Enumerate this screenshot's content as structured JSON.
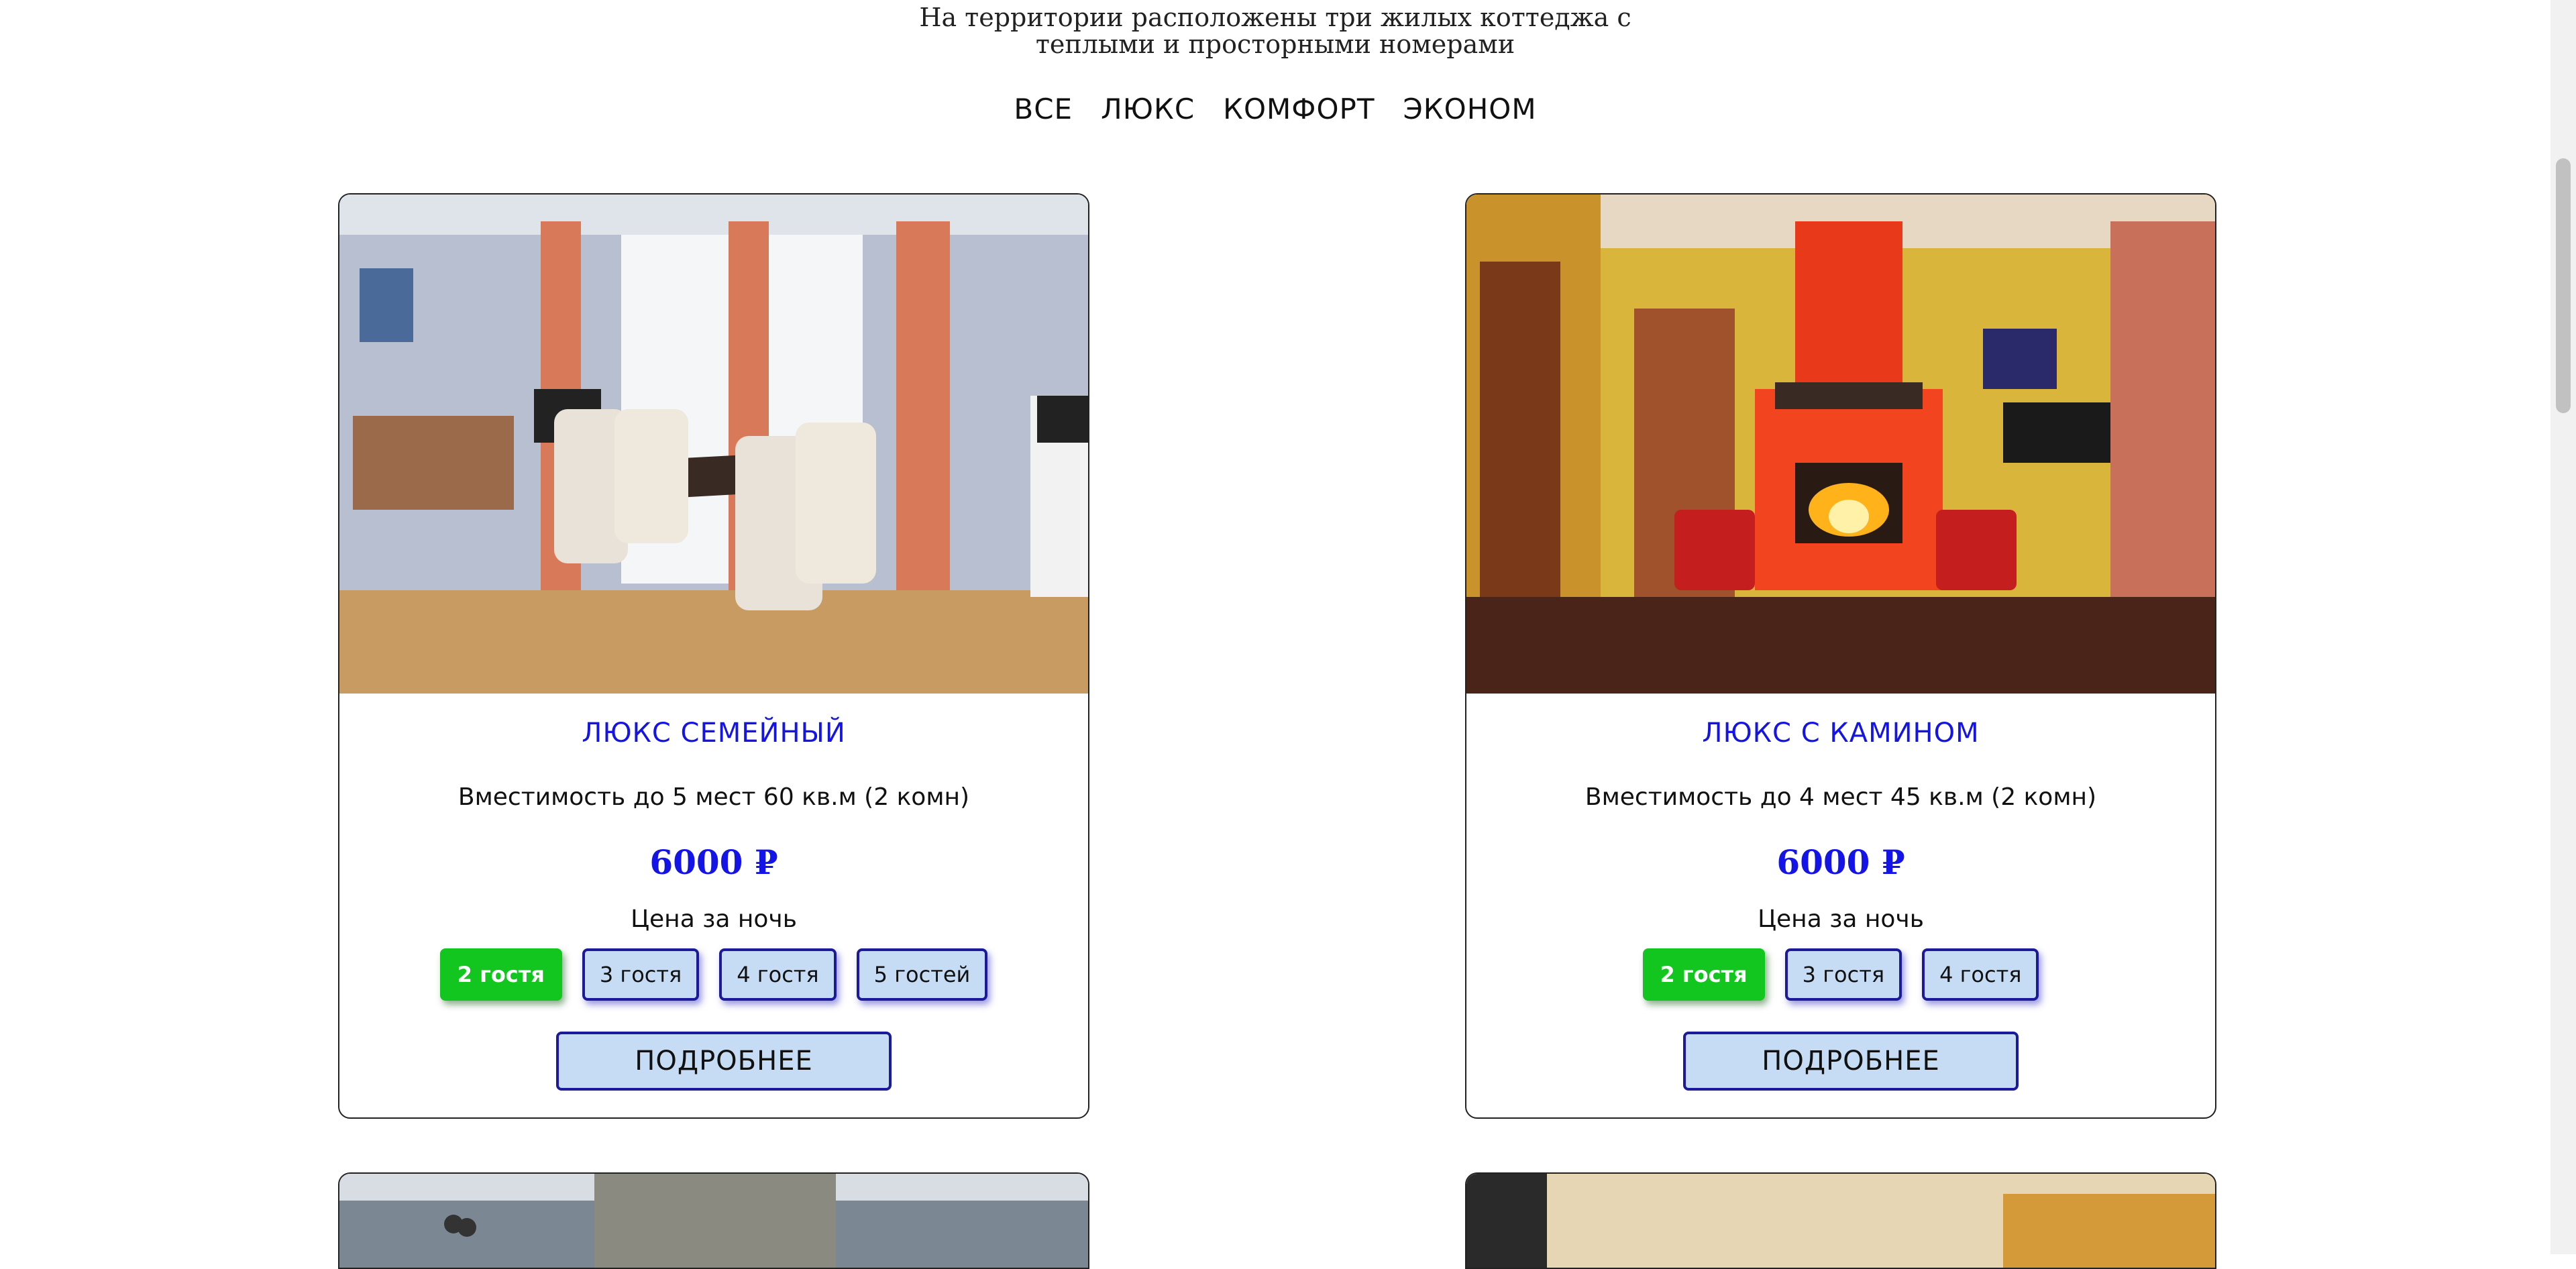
{
  "intro": {
    "line1": "На территории расположены три жилых коттеджа с",
    "line2": "теплыми и просторными номерами"
  },
  "filters": [
    "ВСЕ",
    "ЛЮКС",
    "КОМФОРТ",
    "ЭКОНОМ"
  ],
  "rooms": [
    {
      "title": "ЛЮКС СЕМЕЙНЫЙ",
      "description": "Вместимость до 5 мест 60 кв.м (2 комн)",
      "price": "6000 ₽",
      "price_note": "Цена за ночь",
      "guest_options": [
        "2 гостя",
        "3 гостя",
        "4 гостя",
        "5 гостей"
      ],
      "selected_option": "2 гостя",
      "details_label": "ПОДРОБНЕЕ"
    },
    {
      "title": "ЛЮКС С КАМИНОМ",
      "description": "Вместимость до 4 мест 45 кв.м (2 комн)",
      "price": "6000 ₽",
      "price_note": "Цена за ночь",
      "guest_options": [
        "2 гостя",
        "3 гостя",
        "4 гостя"
      ],
      "selected_option": "2 гостя",
      "details_label": "ПОДРОБНЕЕ"
    }
  ],
  "colors": {
    "accent_blue": "#1414e6",
    "active_green": "#13c61f",
    "button_bg": "#c6dcf5",
    "button_border": "#1a1a9a"
  }
}
